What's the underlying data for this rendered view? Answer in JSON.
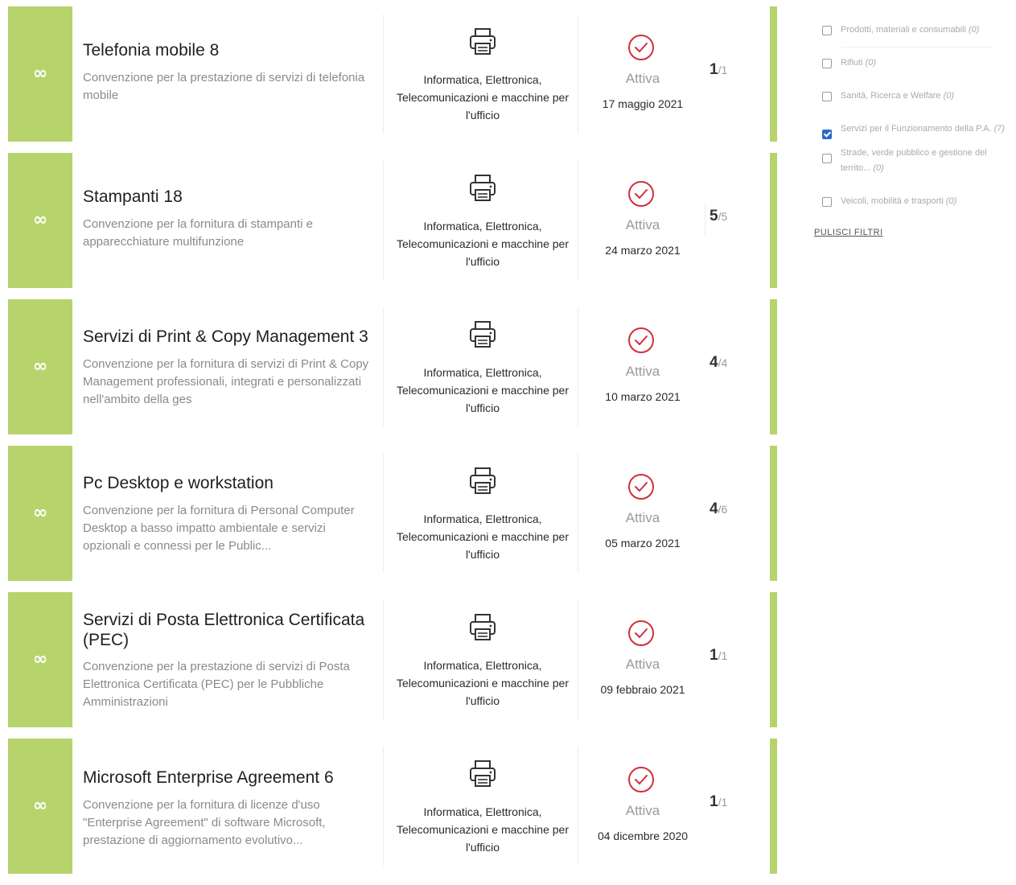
{
  "cards": [
    {
      "title": "Telefonia mobile 8",
      "description": "Convenzione per la prestazione di servizi di telefonia mobile",
      "category": "Informatica, Elettronica, Telecomunicazioni e macchine per l'ufficio",
      "status": "Attiva",
      "date": "17 maggio 2021",
      "count": "1",
      "total": "/1"
    },
    {
      "title": "Stampanti 18",
      "description": "Convenzione per la fornitura di stampanti e apparecchiature multifunzione",
      "category": "Informatica, Elettronica, Telecomunicazioni e macchine per l'ufficio",
      "status": "Attiva",
      "date": "24 marzo 2021",
      "count": "5",
      "total": "/5"
    },
    {
      "title": "Servizi di Print & Copy Management 3",
      "description": "Convenzione per la fornitura di servizi di Print & Copy Management professionali, integrati e personalizzati nell'ambito della ges",
      "category": "Informatica, Elettronica, Telecomunicazioni e macchine per l'ufficio",
      "status": "Attiva",
      "date": "10 marzo 2021",
      "count": "4",
      "total": "/4"
    },
    {
      "title": "Pc Desktop e workstation",
      "description": "Convenzione per la fornitura di Personal Computer Desktop a basso impatto ambientale e servizi opzionali e connessi per le Public...",
      "category": "Informatica, Elettronica, Telecomunicazioni e macchine per l'ufficio",
      "status": "Attiva",
      "date": "05 marzo 2021",
      "count": "4",
      "total": "/6"
    },
    {
      "title": "Servizi di Posta Elettronica Certificata (PEC)",
      "description": "Convenzione per la prestazione di servizi di Posta Elettronica Certificata (PEC) per le Pubbliche Amministrazioni",
      "category": "Informatica, Elettronica, Telecomunicazioni e macchine per l'ufficio",
      "status": "Attiva",
      "date": "09 febbraio 2021",
      "count": "1",
      "total": "/1"
    },
    {
      "title": "Microsoft Enterprise Agreement 6",
      "description": "Convenzione per la fornitura di licenze d'uso \"Enterprise Agreement\" di software Microsoft, prestazione di aggiornamento evolutivo...",
      "category": "Informatica, Elettronica, Telecomunicazioni e macchine per l'ufficio",
      "status": "Attiva",
      "date": "04 dicembre 2020",
      "count": "1",
      "total": "/1"
    }
  ],
  "badge_symbol": "∞",
  "filters": [
    {
      "label": "Prodotti, materiali e consumabili",
      "count": "(0)",
      "checked": false
    },
    {
      "label": "Rifiuti",
      "count": "(0)",
      "checked": false
    },
    {
      "label": "Sanità, Ricerca e Welfare",
      "count": "(0)",
      "checked": false
    },
    {
      "label": "Servizi per il Funzionamento della P.A.",
      "count": "(7)",
      "checked": true
    },
    {
      "label": "Strade, verde pubblico e gestione del territo...",
      "count": "(0)",
      "checked": false
    },
    {
      "label": "Veicoli, mobilità e trasporti",
      "count": "(0)",
      "checked": false
    }
  ],
  "clear_filters_label": "PULISCI FILTRI",
  "colors": {
    "accent_green": "#b7d36c",
    "status_red": "#d0303a",
    "checkbox_blue": "#2b6cc4"
  },
  "icons": {
    "category": "printer-icon",
    "status": "check-circle-icon",
    "badge": "infinity-icon"
  }
}
